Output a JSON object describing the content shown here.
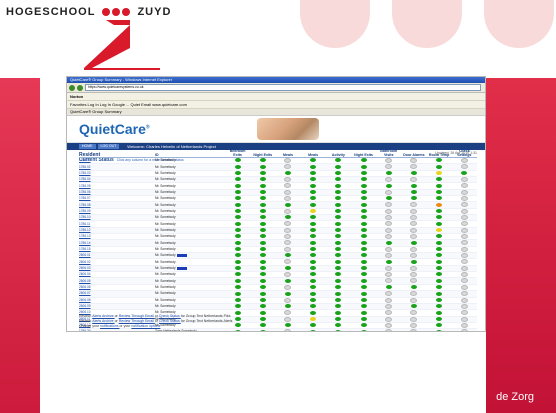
{
  "slide": {
    "brand_left": "HOGESCHOOL",
    "brand_right": "ZUYD",
    "footer_text": "de Zorg",
    "accent_color": "#d81a2b"
  },
  "browser": {
    "title": "QuietCare® Group Summary - Windows Internet Explorer",
    "address": "https://www.quietcaresystems.co.uk",
    "norton_label": "Norton",
    "links_text": "Favorites    Log In    Log In    Google    ...    Quiet Email    www.quietcare.com",
    "tab_label": "QuietCare® Group Summary"
  },
  "app": {
    "logo": "QuietCare",
    "logo_mark": "®",
    "nav_buttons": [
      "HOME",
      "LOG OUT"
    ],
    "welcome": "Welcome: Charles Helvelin of Netherlands Project",
    "updated": "Updated: 26 Apr 2010 1:31",
    "section_title": "Current Status",
    "section_link": "Click any column for a more detailed status",
    "columns": [
      "Resident",
      "ID",
      "Bedroom Exits",
      "Night Exits",
      "Meals",
      "Meals",
      "Activity",
      "Night Exits",
      "Bathroom Visits",
      "Door Alarms",
      "Room Temp",
      "Check Settings"
    ],
    "status_legend": {
      "g": "green",
      "y": "yellow",
      "o": "orange",
      "n": "gray"
    },
    "rows": [
      {
        "res": "1786.01",
        "id": "Mr. Somebody",
        "cells": [
          "g",
          "g",
          "n",
          "g",
          "g",
          "g",
          "n",
          "n",
          "g",
          "n"
        ]
      },
      {
        "res": "1786.02",
        "id": "Mr. Somebody",
        "cells": [
          "g",
          "g",
          "n",
          "g",
          "g",
          "g",
          "n",
          "n",
          "g",
          "n"
        ]
      },
      {
        "res": "1786.03",
        "id": "Mr. Somebody",
        "cells": [
          "g",
          "g",
          "g",
          "g",
          "g",
          "g",
          "g",
          "g",
          "y",
          "g"
        ]
      },
      {
        "res": "1786.04",
        "id": "Mr. Somebody",
        "cells": [
          "g",
          "g",
          "n",
          "g",
          "g",
          "g",
          "n",
          "n",
          "g",
          "n"
        ]
      },
      {
        "res": "1786.05",
        "id": "Mr. Somebody",
        "cells": [
          "g",
          "g",
          "n",
          "g",
          "g",
          "g",
          "g",
          "g",
          "g",
          "n"
        ]
      },
      {
        "res": "1786.06",
        "id": "Mr. Somebody",
        "cells": [
          "g",
          "g",
          "n",
          "g",
          "g",
          "g",
          "n",
          "g",
          "g",
          "n"
        ]
      },
      {
        "res": "1786.07",
        "id": "Mr. Somebody",
        "cells": [
          "g",
          "g",
          "n",
          "g",
          "g",
          "g",
          "g",
          "g",
          "g",
          "n"
        ]
      },
      {
        "res": "1786.08",
        "id": "Mr. Somebody",
        "cells": [
          "g",
          "g",
          "g",
          "g",
          "g",
          "g",
          "n",
          "n",
          "o",
          "n"
        ]
      },
      {
        "res": "1786.09",
        "id": "Mr. Somebody",
        "cells": [
          "g",
          "g",
          "n",
          "y",
          "g",
          "g",
          "n",
          "n",
          "g",
          "n"
        ]
      },
      {
        "res": "1786.10",
        "id": "Mr. Somebody",
        "cells": [
          "g",
          "g",
          "g",
          "g",
          "g",
          "g",
          "n",
          "n",
          "g",
          "n"
        ]
      },
      {
        "res": "1786.11",
        "id": "Mr. Somebody",
        "cells": [
          "g",
          "g",
          "n",
          "g",
          "g",
          "g",
          "n",
          "n",
          "g",
          "n"
        ]
      },
      {
        "res": "1786.12",
        "id": "Mr. Somebody",
        "cells": [
          "g",
          "g",
          "n",
          "g",
          "g",
          "g",
          "n",
          "n",
          "y",
          "n"
        ]
      },
      {
        "res": "1786.13",
        "id": "Mr. Somebody",
        "cells": [
          "g",
          "g",
          "n",
          "g",
          "g",
          "g",
          "n",
          "n",
          "g",
          "n"
        ]
      },
      {
        "res": "1786.14",
        "id": "Mr. Somebody",
        "cells": [
          "g",
          "g",
          "n",
          "g",
          "g",
          "g",
          "g",
          "g",
          "g",
          "n"
        ]
      },
      {
        "res": "1786.15",
        "id": "Mr. Somebody",
        "cells": [
          "g",
          "g",
          "n",
          "g",
          "g",
          "g",
          "n",
          "n",
          "g",
          "n"
        ]
      },
      {
        "res": "2606.01",
        "id": "Mr. Somebody",
        "cells": [
          "g",
          "g",
          "g",
          "g",
          "g",
          "g",
          "n",
          "n",
          "g",
          "n"
        ],
        "bar": true
      },
      {
        "res": "2606.02",
        "id": "Mr. Somebody",
        "cells": [
          "g",
          "g",
          "n",
          "g",
          "g",
          "g",
          "g",
          "g",
          "g",
          "n"
        ]
      },
      {
        "res": "2606.03",
        "id": "Mr. Somebody",
        "cells": [
          "g",
          "g",
          "g",
          "g",
          "g",
          "g",
          "n",
          "n",
          "g",
          "n"
        ],
        "bar": true
      },
      {
        "res": "2606.04",
        "id": "Mr. Somebody",
        "cells": [
          "g",
          "g",
          "n",
          "g",
          "g",
          "g",
          "n",
          "n",
          "g",
          "n"
        ]
      },
      {
        "res": "2606.05",
        "id": "Mr. Somebody",
        "cells": [
          "g",
          "g",
          "g",
          "g",
          "g",
          "g",
          "n",
          "n",
          "g",
          "n"
        ]
      },
      {
        "res": "2606.06",
        "id": "Mr. Somebody",
        "cells": [
          "g",
          "g",
          "n",
          "g",
          "g",
          "g",
          "g",
          "g",
          "g",
          "n"
        ]
      },
      {
        "res": "2606.07",
        "id": "Mr. Somebody",
        "cells": [
          "g",
          "g",
          "g",
          "g",
          "g",
          "g",
          "n",
          "n",
          "g",
          "n"
        ]
      },
      {
        "res": "2606.08",
        "id": "Mr. Somebody",
        "cells": [
          "g",
          "g",
          "n",
          "g",
          "g",
          "g",
          "n",
          "n",
          "g",
          "n"
        ]
      },
      {
        "res": "2606.09",
        "id": "Mr. Somebody",
        "cells": [
          "g",
          "g",
          "g",
          "g",
          "g",
          "g",
          "n",
          "g",
          "g",
          "n"
        ]
      },
      {
        "res": "2606.10",
        "id": "Mr. Somebody",
        "cells": [
          "g",
          "g",
          "n",
          "g",
          "g",
          "g",
          "n",
          "n",
          "g",
          "n"
        ]
      },
      {
        "res": "2606.11",
        "id": "Mr. Somebody",
        "cells": [
          "g",
          "g",
          "n",
          "y",
          "g",
          "g",
          "n",
          "n",
          "g",
          "n"
        ]
      },
      {
        "res": "2606.12",
        "id": "Mr. Somebody",
        "cells": [
          "g",
          "g",
          "g",
          "g",
          "g",
          "g",
          "n",
          "n",
          "g",
          "n"
        ]
      },
      {
        "res": "1786.30",
        "id": "Town Netherlands Somebody",
        "cells": [
          "g",
          "g",
          "n",
          "g",
          "g",
          "g",
          "n",
          "n",
          "g",
          "n"
        ]
      },
      {
        "res": "1786.31",
        "id": "Town Netherlands Somebody",
        "cells": [
          "g",
          "g",
          "g",
          "g",
          "g",
          "g",
          "n",
          "n",
          "g",
          "n"
        ],
        "bar": true
      },
      {
        "res": "1786.32",
        "id": "Town Netherlands Somebody",
        "cells": [
          "g",
          "g",
          "n",
          "g",
          "g",
          "g",
          "n",
          "n",
          "g",
          "n"
        ]
      },
      {
        "res": "Total Netherlands Alerts",
        "id": "",
        "cells": [
          "",
          "",
          "",
          "",
          "",
          "",
          "",
          "",
          "",
          ""
        ]
      }
    ],
    "footer_lines": [
      {
        "a": "Review:",
        "b": "Alerts Archive",
        "c": "or",
        "d": "Review Through Email",
        "e": "or",
        "f": "Check Status",
        "g": "for Group Text Netherlands Pilot"
      },
      {
        "a": "Review:",
        "b": "Alerts Archive",
        "c": "or",
        "d": "Review Through Email",
        "e": "or",
        "f": "Check Status",
        "g": "for Group Text Netherlands Alerts"
      },
      {
        "a": "Change your",
        "b": "notifications",
        "c": "or your",
        "d": "notification options",
        "e": "",
        "f": "",
        "g": ""
      }
    ]
  }
}
